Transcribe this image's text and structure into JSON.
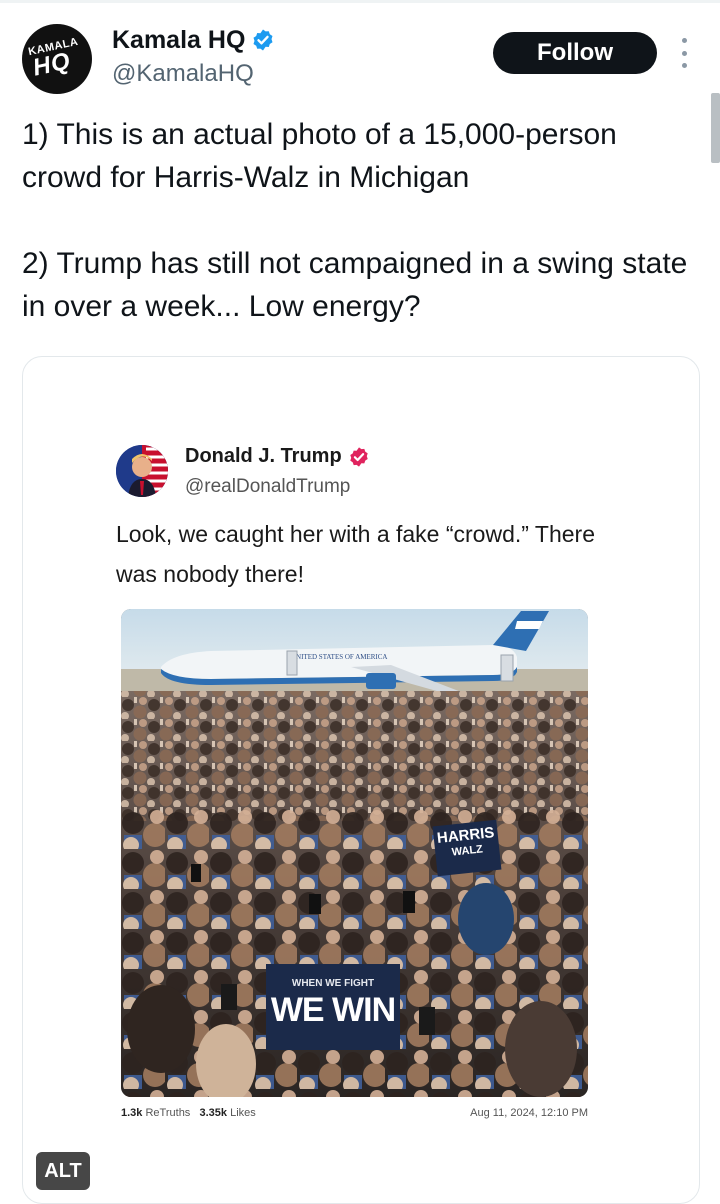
{
  "author": {
    "name": "Kamala HQ",
    "handle": "@KamalaHQ",
    "avatar_text_top": "KAMALA",
    "avatar_text_main": "HQ",
    "follow_label": "Follow"
  },
  "tweet": {
    "paragraph_1": "1) This is an actual photo of a 15,000-person crowd for Harris-Walz in Michigan",
    "paragraph_2": "2) Trump has still not campaigned in a swing state in over a week... Low energy?"
  },
  "embedded_post": {
    "name": "Donald J. Trump",
    "handle": "@realDonaldTrump",
    "text": "Look, we caught her with a fake “crowd.” There was nobody there!",
    "photo": {
      "plane_lettering": "UNITED STATES OF AMERICA",
      "sign_1_line_1": "HARRIS",
      "sign_1_line_2": "WALZ",
      "sign_2_line_1": "WHEN WE FIGHT",
      "sign_2_line_2": "WE WIN"
    },
    "retruths_count": "1.3k",
    "retruths_label": "ReTruths",
    "likes_count": "3.35k",
    "likes_label": "Likes",
    "timestamp": "Aug 11, 2024, 12:10 PM"
  },
  "alt_badge": "ALT",
  "colors": {
    "verified_blue": "#1d9bf0",
    "truth_verified": "#e0245e",
    "follow_bg": "#0f1419"
  }
}
